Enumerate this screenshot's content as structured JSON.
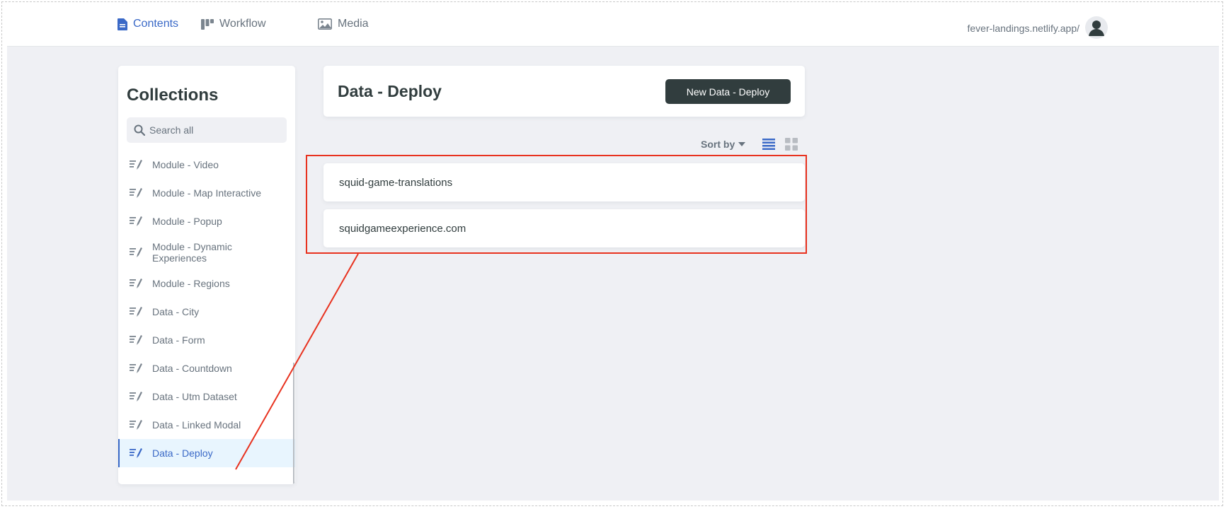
{
  "nav": {
    "items": [
      {
        "label": "Contents",
        "active": true
      },
      {
        "label": "Workflow",
        "active": false
      },
      {
        "label": "Media",
        "active": false
      }
    ],
    "site_url": "fever-landings.netlify.app/"
  },
  "sidebar": {
    "title": "Collections",
    "search_placeholder": "Search all",
    "items": [
      {
        "label": "Module - Video"
      },
      {
        "label": "Module - Map Interactive"
      },
      {
        "label": "Module - Popup"
      },
      {
        "label": "Module - Dynamic Experiences"
      },
      {
        "label": "Module - Regions"
      },
      {
        "label": "Data - City"
      },
      {
        "label": "Data - Form"
      },
      {
        "label": "Data - Countdown"
      },
      {
        "label": "Data - Utm Dataset"
      },
      {
        "label": "Data - Linked Modal"
      },
      {
        "label": "Data - Deploy",
        "active": true
      }
    ]
  },
  "collection": {
    "title": "Data - Deploy",
    "new_button": "New Data - Deploy",
    "sort_label": "Sort by",
    "view_mode": "list",
    "entries": [
      {
        "title": "squid-game-translations"
      },
      {
        "title": "squidgameexperience.com"
      }
    ]
  },
  "colors": {
    "accent": "#3a69c7",
    "dark_button": "#313d3e",
    "annotation": "#e8321f",
    "background": "#eff0f4"
  },
  "icons": {
    "contents": "document-icon",
    "workflow": "workflow-columns-icon",
    "media": "image-icon",
    "user": "user-avatar-icon",
    "search": "search-icon",
    "collection": "write-collection-icon",
    "sort": "caret-down-icon",
    "list_view": "list-view-icon",
    "grid_view": "grid-view-icon"
  }
}
